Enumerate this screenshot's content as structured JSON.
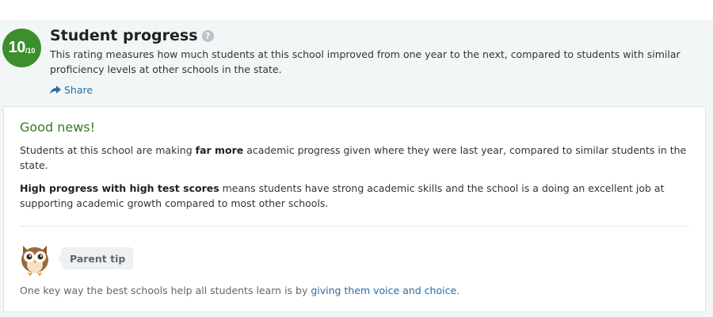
{
  "header": {
    "rating_score": "10",
    "rating_outof": "/10",
    "title": "Student progress",
    "help_symbol": "?",
    "description": "This rating measures how much students at this school improved from one year to the next, compared to students with similar proficiency levels at other schools in the state.",
    "share_label": "Share",
    "badge_color": "#3c8f2c"
  },
  "card": {
    "heading": "Good news!",
    "p1_before": "Students at this school are making ",
    "p1_bold": "far more",
    "p1_after": " academic progress given where they were last year, compared to similar students in the state.",
    "p2_bold": "High progress with high test scores",
    "p2_after": " means students have strong academic skills and the school is a doing an excellent job at supporting academic growth compared to most other schools.",
    "tip_label": "Parent tip",
    "tip_text_before": "One key way the best schools help all students learn is by ",
    "tip_link": "giving them voice and choice",
    "tip_text_after": "."
  },
  "icons": {
    "help": "question-circle-icon",
    "share": "share-arrow-icon",
    "mascot": "owl-icon"
  }
}
